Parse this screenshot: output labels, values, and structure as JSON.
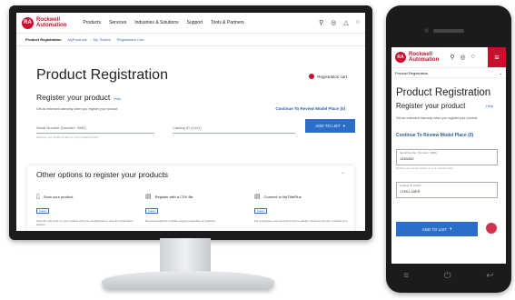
{
  "brand": {
    "mark": "RA",
    "line1": "Rockwell",
    "line2": "Automation"
  },
  "desktop": {
    "nav": [
      "Products",
      "Services",
      "Industries & Solutions",
      "Support",
      "Tools & Partners"
    ],
    "subnav": {
      "active": "Product Registration",
      "links": [
        "MyProducts",
        "My Tickets",
        "Registration Cart"
      ]
    },
    "title": "Product Registration",
    "cart_label": "Registration cart",
    "section_title": "Register your product",
    "help": "Help",
    "description": "Get an extended warranty when you register your product",
    "continue_link": "Continue To Review Model Place (0)",
    "field_serial": "Serial Number (Number: 4984)",
    "field_catalog": "Catalog ID (1441)",
    "field_note": "Retrieve your serial number on your product's label",
    "add_button": "ADD TO LIST",
    "other_title": "Other options to register your products",
    "options": [
      {
        "title": "Scan your product",
        "tag": "Select",
        "text": "Scan the QR code on your product with your smartphone to view the information section"
      },
      {
        "title": "Register with a CSV file",
        "tag": "Select",
        "text": "Recommended for multiple ongoing quantities of products"
      },
      {
        "title": "Connect to MyTitlePlus",
        "tag": "Select",
        "text": "For employees, use Connect Fund to quickly customize all your products at a"
      }
    ]
  },
  "mobile": {
    "breadcrumb": "Product Registration",
    "title": "Product Registration",
    "section_title": "Register your product",
    "help": "Help",
    "description": "Get an extended warranty when you register your product",
    "continue_link": "Continue To Review Model Place (0)",
    "serial_label": "Serial Number (Number: 4984)",
    "serial_value": "1483452",
    "note": "Retrieve your serial number on your product's label",
    "catalog_label": "Catalog ID (1441)",
    "catalog_value": "1769-L33ER",
    "add_button": "ADD TO LIST"
  },
  "icons": [
    "search-icon",
    "globe-icon",
    "bell-icon",
    "user-icon",
    "menu-icon",
    "chevron-down-icon",
    "phone-icon",
    "csv-icon",
    "connect-icon",
    "cart-icon"
  ],
  "colors": {
    "brand": "#c8102e",
    "primary": "#2b6ec9",
    "link": "#2b5ca8"
  }
}
